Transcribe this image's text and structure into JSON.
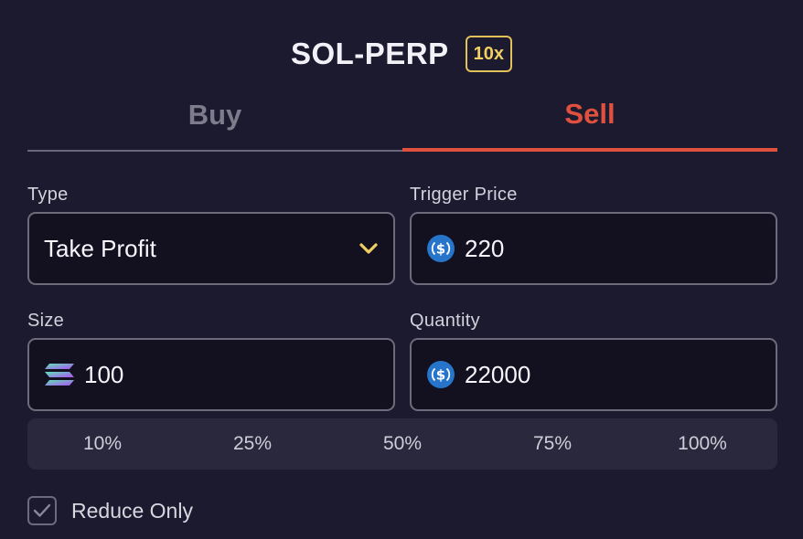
{
  "header": {
    "market": "SOL-PERP",
    "leverage": "10x"
  },
  "tabs": [
    {
      "label": "Buy",
      "active": false
    },
    {
      "label": "Sell",
      "active": true
    }
  ],
  "form": {
    "type": {
      "label": "Type",
      "value": "Take Profit"
    },
    "trigger_price": {
      "label": "Trigger Price",
      "value": "220",
      "icon": "usdc-icon"
    },
    "size": {
      "label": "Size",
      "value": "100",
      "icon": "sol-icon"
    },
    "quantity": {
      "label": "Quantity",
      "value": "22000",
      "icon": "usdc-icon"
    }
  },
  "percent_options": [
    "10%",
    "25%",
    "50%",
    "75%",
    "100%"
  ],
  "reduce_only": {
    "label": "Reduce Only",
    "checked": true
  },
  "colors": {
    "background": "#1c1a2e",
    "sell_accent": "#e0503f",
    "leverage_accent": "#e2c15a",
    "usdc_blue": "#2775ca"
  }
}
